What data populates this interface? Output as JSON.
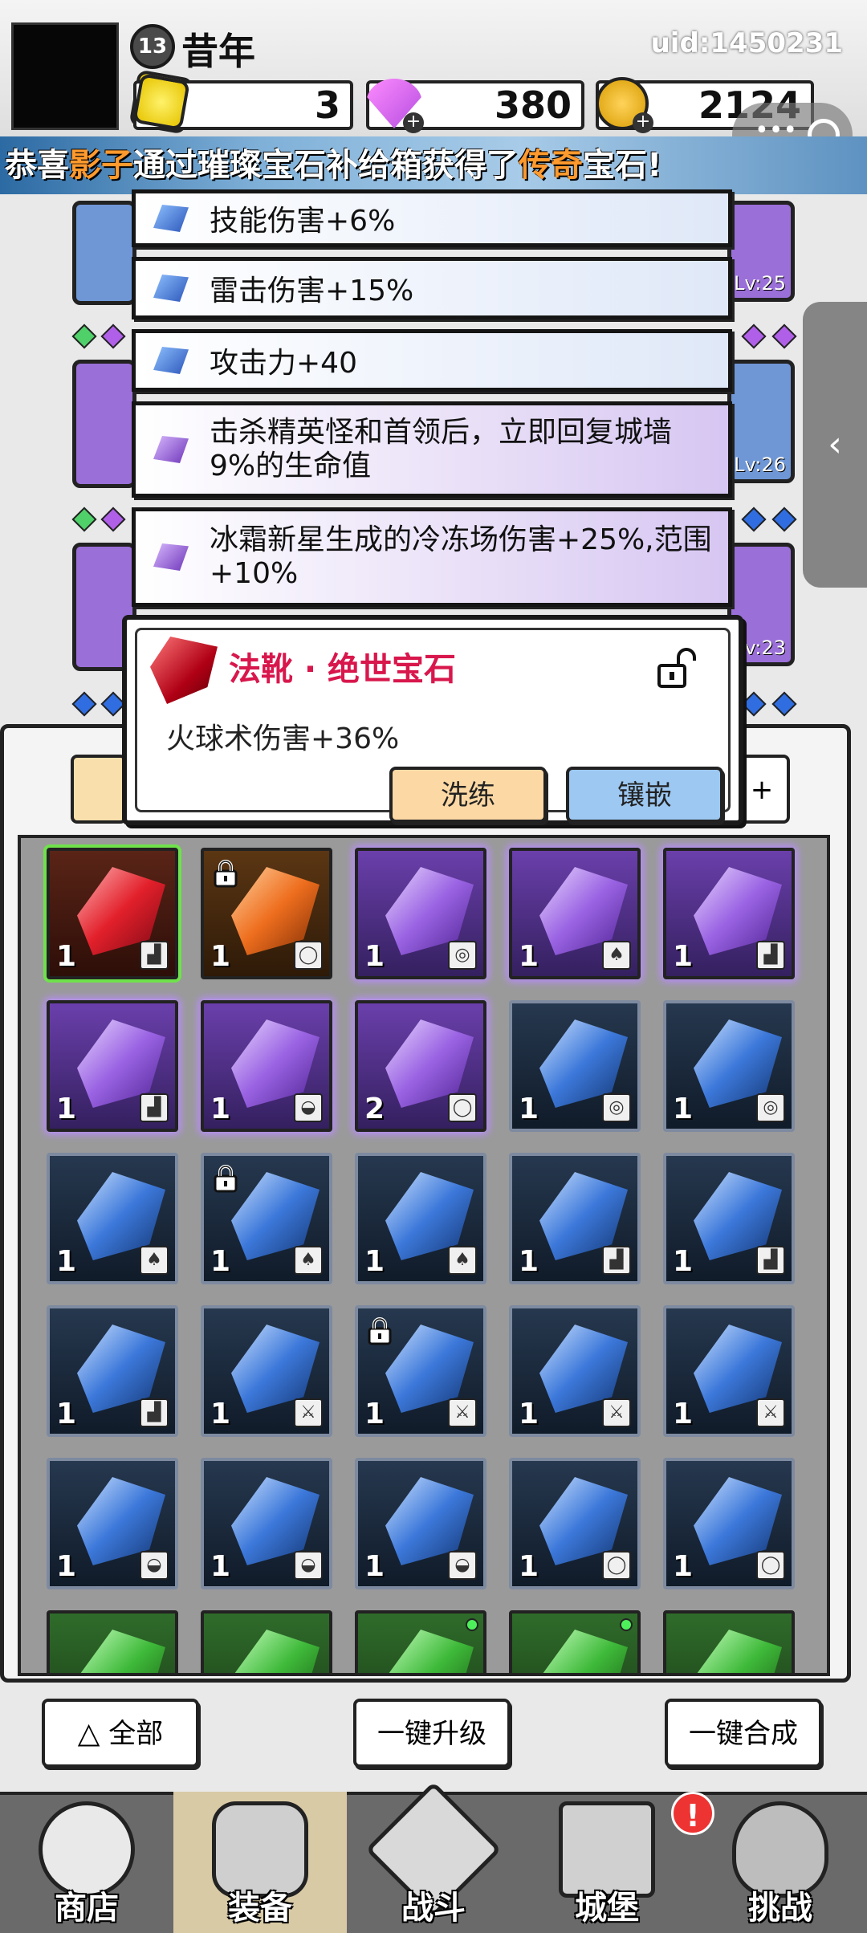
{
  "header": {
    "level": "13",
    "player_name": "昔年",
    "uid": "uid:1450231",
    "resources": {
      "gold_tokens": "3",
      "gems": "380",
      "coins": "2124"
    }
  },
  "banner": {
    "prefix": "恭喜",
    "player": "影子",
    "middle": "通过璀璨宝石补给箱获得了",
    "rarity": "传奇",
    "suffix": "宝石!"
  },
  "background_slots": {
    "levels": [
      "Lv:25",
      "Lv:26",
      "Lv:23"
    ]
  },
  "affixes": [
    {
      "text": "技能伤害+6%",
      "gem": "blue"
    },
    {
      "text": "雷击伤害+15%",
      "gem": "blue"
    },
    {
      "text": "攻击力+40",
      "gem": "blue"
    },
    {
      "text": "击杀精英怪和首领后，立即回复城墙9%的生命值",
      "gem": "purple"
    },
    {
      "text": "冰霜新星生成的冷冻场伤害+25%,范围+10%",
      "gem": "purple"
    }
  ],
  "popup": {
    "title": "法靴 · 绝世宝石",
    "effect": "火球术伤害+36%",
    "refine_label": "洗练",
    "inlay_label": "镶嵌"
  },
  "inventory": {
    "right_tab_label": "+",
    "rows": [
      [
        {
          "color": "red",
          "count": "1",
          "slot": "boot",
          "lock": false,
          "dot": false
        },
        {
          "color": "orange",
          "count": "1",
          "slot": "necklace",
          "lock": true,
          "dot": false
        },
        {
          "color": "purple",
          "count": "1",
          "slot": "ring",
          "lock": false,
          "dot": false
        },
        {
          "color": "purple",
          "count": "1",
          "slot": "armor",
          "lock": false,
          "dot": false
        },
        {
          "color": "purple",
          "count": "1",
          "slot": "boot",
          "lock": false,
          "dot": false
        }
      ],
      [
        {
          "color": "purple",
          "count": "1",
          "slot": "boot",
          "lock": false,
          "dot": false
        },
        {
          "color": "purple",
          "count": "1",
          "slot": "hat",
          "lock": false,
          "dot": false
        },
        {
          "color": "purple",
          "count": "2",
          "slot": "necklace",
          "lock": false,
          "dot": false
        },
        {
          "color": "blue",
          "count": "1",
          "slot": "ring",
          "lock": false,
          "dot": false
        },
        {
          "color": "blue",
          "count": "1",
          "slot": "ring",
          "lock": false,
          "dot": false
        }
      ],
      [
        {
          "color": "blue",
          "count": "1",
          "slot": "armor",
          "lock": false,
          "dot": false
        },
        {
          "color": "blue",
          "count": "1",
          "slot": "armor",
          "lock": true,
          "dot": false
        },
        {
          "color": "blue",
          "count": "1",
          "slot": "armor",
          "lock": false,
          "dot": false
        },
        {
          "color": "blue",
          "count": "1",
          "slot": "boot",
          "lock": false,
          "dot": false
        },
        {
          "color": "blue",
          "count": "1",
          "slot": "boot",
          "lock": false,
          "dot": false
        }
      ],
      [
        {
          "color": "blue",
          "count": "1",
          "slot": "boot",
          "lock": false,
          "dot": false
        },
        {
          "color": "blue",
          "count": "1",
          "slot": "weapon",
          "lock": false,
          "dot": false
        },
        {
          "color": "blue",
          "count": "1",
          "slot": "weapon",
          "lock": true,
          "dot": false
        },
        {
          "color": "blue",
          "count": "1",
          "slot": "weapon",
          "lock": false,
          "dot": false
        },
        {
          "color": "blue",
          "count": "1",
          "slot": "weapon",
          "lock": false,
          "dot": false
        }
      ],
      [
        {
          "color": "blue",
          "count": "1",
          "slot": "hat",
          "lock": false,
          "dot": false
        },
        {
          "color": "blue",
          "count": "1",
          "slot": "hat",
          "lock": false,
          "dot": false
        },
        {
          "color": "blue",
          "count": "1",
          "slot": "hat",
          "lock": false,
          "dot": false
        },
        {
          "color": "blue",
          "count": "1",
          "slot": "necklace",
          "lock": false,
          "dot": false
        },
        {
          "color": "blue",
          "count": "1",
          "slot": "necklace",
          "lock": false,
          "dot": false
        }
      ],
      [
        {
          "color": "green",
          "count": "",
          "slot": "",
          "lock": false,
          "dot": false
        },
        {
          "color": "green",
          "count": "",
          "slot": "",
          "lock": false,
          "dot": false
        },
        {
          "color": "green",
          "count": "",
          "slot": "",
          "lock": false,
          "dot": true
        },
        {
          "color": "green",
          "count": "",
          "slot": "",
          "lock": false,
          "dot": true
        },
        {
          "color": "green",
          "count": "",
          "slot": "",
          "lock": false,
          "dot": false
        }
      ]
    ]
  },
  "actions": {
    "filter_label": "全部",
    "upgrade_all_label": "一键升级",
    "merge_all_label": "一键合成"
  },
  "nav": {
    "items": [
      "商店",
      "装备",
      "战斗",
      "城堡",
      "挑战"
    ],
    "badge": "!"
  }
}
